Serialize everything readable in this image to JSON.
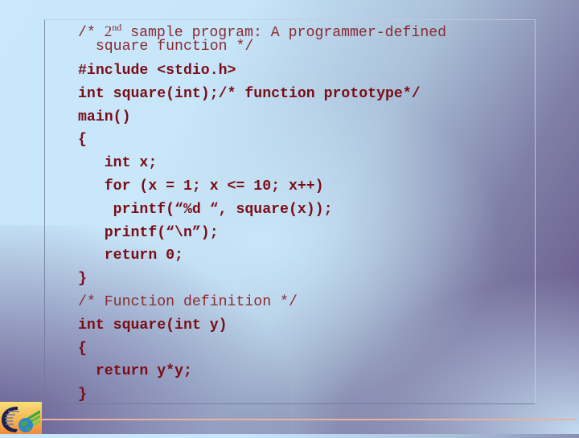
{
  "slide": {
    "code_lines": [
      {
        "type": "comment-sup",
        "prefix": "/* ",
        "sup_base": "2",
        "sup": "nd",
        "suffix": " sample program: A programmer-defined"
      },
      {
        "type": "comment",
        "text": "  square function */"
      },
      {
        "type": "code",
        "text": "#include <stdio.h>"
      },
      {
        "type": "code",
        "text": "int square(int);/* function prototype*/"
      },
      {
        "type": "code",
        "text": "main()"
      },
      {
        "type": "code",
        "text": "{"
      },
      {
        "type": "code",
        "text": "   int x;"
      },
      {
        "type": "code",
        "text": "   for (x = 1; x <= 10; x++)"
      },
      {
        "type": "code",
        "text": "    printf(“%d “, square(x));"
      },
      {
        "type": "code",
        "text": "   printf(“\\n”);"
      },
      {
        "type": "code",
        "text": "   return 0;"
      },
      {
        "type": "code",
        "text": "}"
      },
      {
        "type": "comment",
        "text": "/* Function definition */"
      },
      {
        "type": "code",
        "text": "int square(int y)"
      },
      {
        "type": "code",
        "text": "{"
      },
      {
        "type": "code",
        "text": "  return y*y;"
      },
      {
        "type": "code",
        "text": "}"
      }
    ]
  },
  "logo": {
    "icon": "globe-logo-icon"
  },
  "colors": {
    "code_text": "#7a0c16",
    "comment_text": "#8a2a30",
    "footer_line": "#e7b3a0"
  }
}
